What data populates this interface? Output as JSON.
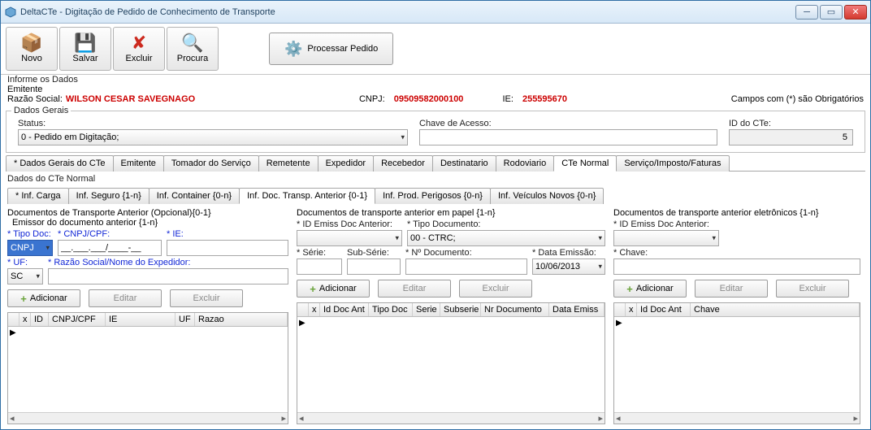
{
  "window": {
    "title": "DeltaCTe - Digitação de Pedido de Conhecimento de Transporte"
  },
  "toolbar": {
    "novo": "Novo",
    "salvar": "Salvar",
    "excluir": "Excluir",
    "procura": "Procura",
    "processar": "Processar Pedido"
  },
  "section": {
    "informe": "Informe os Dados",
    "emitente": "Emitente"
  },
  "emit": {
    "rs_label": "Razão Social:",
    "rs_value": "WILSON CESAR SAVEGNAGO",
    "cnpj_label": "CNPJ:",
    "cnpj_value": "09509582000100",
    "ie_label": "IE:",
    "ie_value": "255595670",
    "obrig": "Campos com (*) são Obrigatórios"
  },
  "gerais": {
    "legend": "Dados Gerais",
    "status_label": "Status:",
    "status_value": "0 - Pedido em Digitação;",
    "chave_label": "Chave de Acesso:",
    "chave_value": "",
    "id_label": "ID do CTe:",
    "id_value": "5"
  },
  "tabs_main": [
    "* Dados Gerais do CTe",
    "Emitente",
    "Tomador do Serviço",
    "Remetente",
    "Expedidor",
    "Recebedor",
    "Destinatario",
    "Rodoviario",
    "CTe Normal",
    "Serviço/Imposto/Faturas"
  ],
  "tabs_main_active": 8,
  "cte_normal_heading": "Dados do CTe Normal",
  "subtabs": [
    "* Inf. Carga",
    "Inf. Seguro {1-n}",
    "Inf. Container {0-n}",
    "Inf. Doc. Transp. Anterior {0-1}",
    "Inf. Prod. Perigosos {0-n}",
    "Inf. Veículos Novos {0-n}"
  ],
  "subtabs_active": 3,
  "col1": {
    "title": "Documentos de Transporte Anterior (Opcional){0-1}",
    "sub": "Emissor do documento anterior {1-n}",
    "tipo_doc_label": "* Tipo Doc:",
    "tipo_doc_value": "CNPJ",
    "cnpj_label": "* CNPJ/CPF:",
    "cnpj_value": "__.___.___/____-__",
    "ie_label": "* IE:",
    "uf_label": "* UF:",
    "uf_value": "SC",
    "razao_label": "* Razão Social/Nome do Expedidor:",
    "add": "Adicionar",
    "edit": "Editar",
    "del": "Excluir",
    "headers": [
      "x",
      "ID",
      "CNPJ/CPF",
      "IE",
      "UF",
      "Razao"
    ]
  },
  "col2": {
    "title": "Documentos de transporte anterior em papel {1-n}",
    "id_label": "* ID Emiss Doc Anterior:",
    "tipo_label": "* Tipo Documento:",
    "tipo_value": "00 - CTRC;",
    "serie_label": "* Série:",
    "subserie_label": "Sub-Série:",
    "num_label": "* Nº Documento:",
    "data_label": "* Data Emissão:",
    "data_value": "10/06/2013",
    "add": "Adicionar",
    "edit": "Editar",
    "del": "Excluir",
    "headers": [
      "x",
      "Id Doc Ant",
      "Tipo Doc",
      "Serie",
      "Subserie",
      "Nr Documento",
      "Data Emiss"
    ]
  },
  "col3": {
    "title": "Documentos de transporte anterior eletrônicos {1-n}",
    "id_label": "* ID Emiss Doc Anterior:",
    "chave_label": "* Chave:",
    "add": "Adicionar",
    "edit": "Editar",
    "del": "Excluir",
    "headers": [
      "x",
      "Id Doc Ant",
      "Chave"
    ]
  }
}
